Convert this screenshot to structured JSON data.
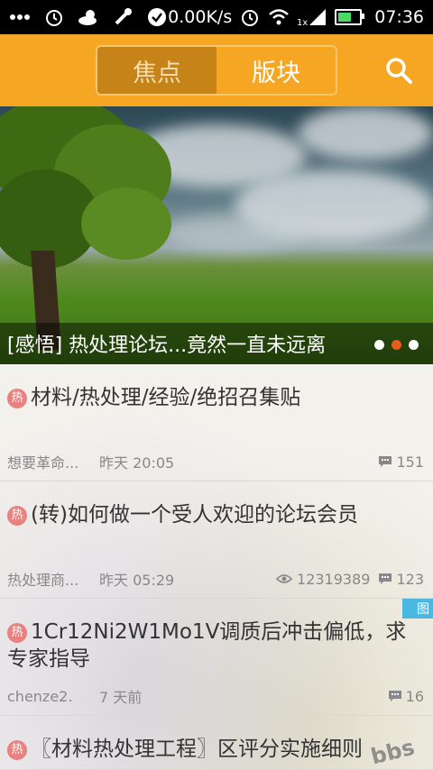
{
  "status_bar": {
    "net_speed": "0.00K/s",
    "network_label": "1x",
    "time": "07:36"
  },
  "header": {
    "tabs": [
      {
        "label": "焦点",
        "active": true
      },
      {
        "label": "版块",
        "active": false
      }
    ]
  },
  "banner": {
    "caption": "[感悟] 热处理论坛...竟然一直未远离",
    "pages": 3,
    "active_page": 2
  },
  "hot_badge": "热",
  "posts": [
    {
      "title": "材料/热处理/经验/绝招召集贴",
      "author": "想要革命...",
      "time": "昨天 20:05",
      "views": "",
      "comments": "151",
      "image_tag": ""
    },
    {
      "title": "(转)如何做一个受人欢迎的论坛会员",
      "author": "热处理商...",
      "time": "昨天 05:29",
      "views": "12319389",
      "comments": "123",
      "image_tag": ""
    },
    {
      "title": "1Cr12Ni2W1Mo1V调质后冲击偏低，求专家指导",
      "author": "chenze2.",
      "time": "7 天前",
      "views": "",
      "comments": "16",
      "image_tag": "图"
    },
    {
      "title": "〖材料热处理工程〗区评分实施细则",
      "author": "",
      "time": "",
      "views": "",
      "comments": "",
      "image_tag": ""
    }
  ],
  "watermark": "bbs",
  "colors": {
    "header": "#f5a623",
    "active_dot": "#e85d1a",
    "hot_badge": "#e8817f",
    "image_tag": "#4ab8e0"
  }
}
